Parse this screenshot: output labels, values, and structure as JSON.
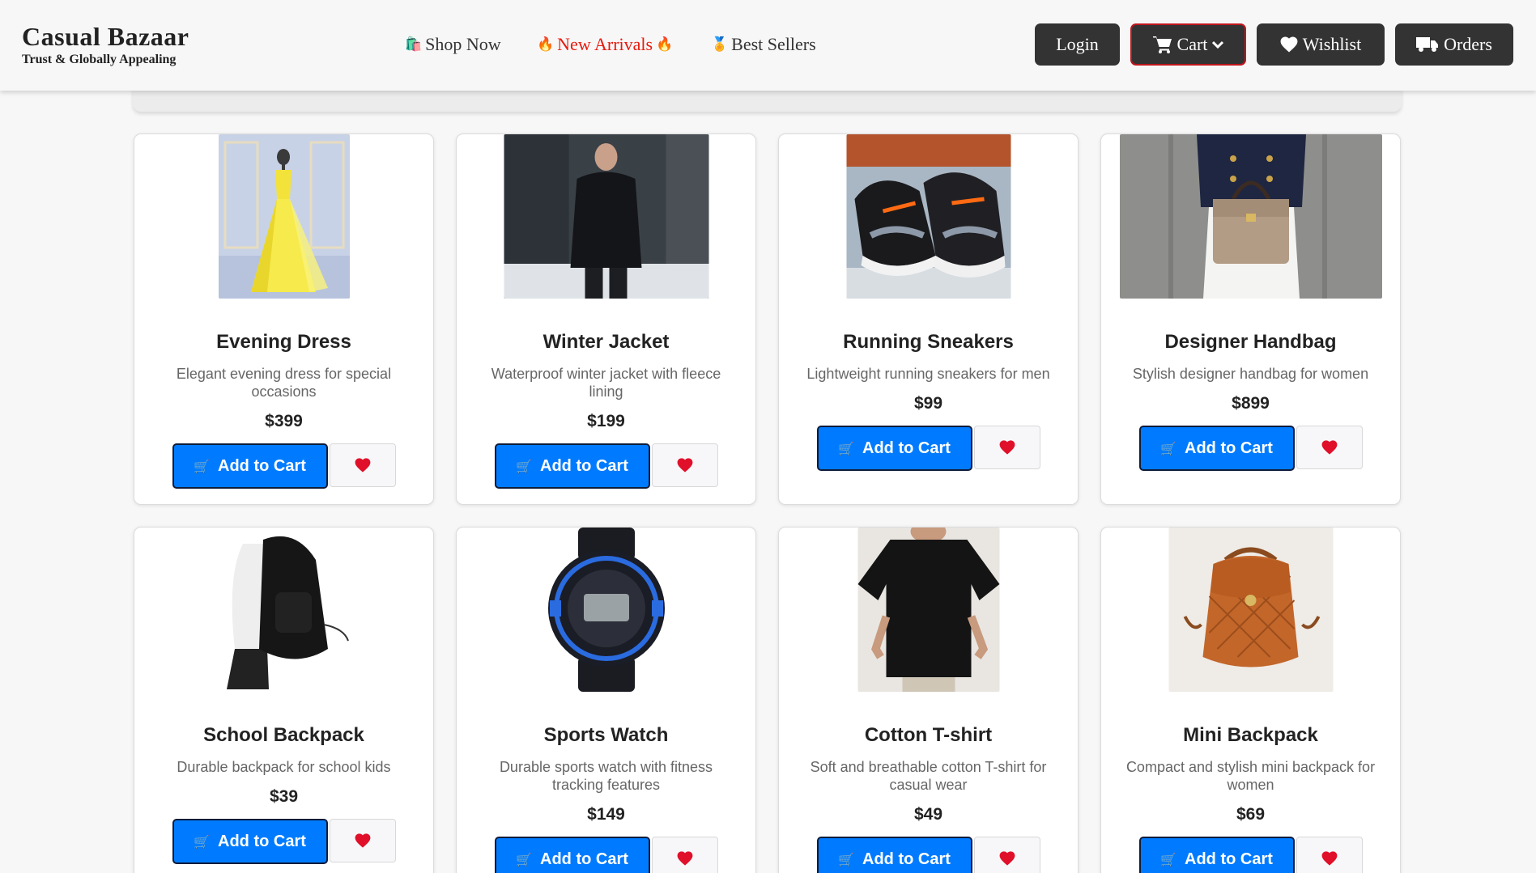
{
  "brand": {
    "title": "Casual Bazaar",
    "tagline": "Trust & Globally Appealing"
  },
  "nav": {
    "shop": {
      "icon": "🛍️",
      "label": "Shop Now"
    },
    "arrivals": {
      "icon": "🔥",
      "label": "New Arrivals"
    },
    "best": {
      "icon": "🏅",
      "label": "Best Sellers"
    }
  },
  "header_buttons": {
    "login": "Login",
    "cart": "Cart",
    "wishlist": "Wishlist",
    "orders": "Orders"
  },
  "colors": {
    "accent": "#007bff",
    "header_button": "#333333",
    "arrivals": "#e8190d",
    "heart": "#e0102a"
  },
  "product_button_icon": "🛒",
  "products": [
    {
      "title": "Evening Dress",
      "desc": "Elegant evening dress for special occasions",
      "price": "$399",
      "add_label": "Add to Cart"
    },
    {
      "title": "Winter Jacket",
      "desc": "Waterproof winter jacket with fleece lining",
      "price": "$199",
      "add_label": "Add to Cart"
    },
    {
      "title": "Running Sneakers",
      "desc": "Lightweight running sneakers for men",
      "price": "$99",
      "add_label": "Add to Cart"
    },
    {
      "title": "Designer Handbag",
      "desc": "Stylish designer handbag for women",
      "price": "$899",
      "add_label": "Add to Cart"
    },
    {
      "title": "School Backpack",
      "desc": "Durable backpack for school kids",
      "price": "$39",
      "add_label": "Add to Cart"
    },
    {
      "title": "Sports Watch",
      "desc": "Durable sports watch with fitness tracking features",
      "price": "$149",
      "add_label": "Add to Cart"
    },
    {
      "title": "Cotton T-shirt",
      "desc": "Soft and breathable cotton T-shirt for casual wear",
      "price": "$49",
      "add_label": "Add to Cart"
    },
    {
      "title": "Mini Backpack",
      "desc": "Compact and stylish mini backpack for women",
      "price": "$69",
      "add_label": "Add to Cart"
    }
  ]
}
